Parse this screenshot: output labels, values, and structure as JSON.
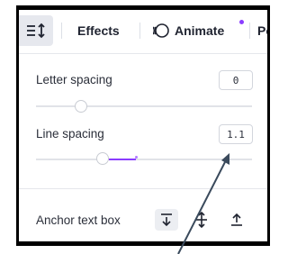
{
  "toolbar": {
    "effects_label": "Effects",
    "animate_label": "Animate",
    "more_label": "Po",
    "animate_dot_color": "#8b3dff"
  },
  "letter_spacing": {
    "label": "Letter spacing",
    "value": "0",
    "slider_fraction": 0.0
  },
  "line_spacing": {
    "label": "Line spacing",
    "value": "1.1",
    "accent_color": "#8b3dff"
  },
  "anchor": {
    "label": "Anchor text box",
    "options": [
      "anchor-bottom",
      "anchor-middle",
      "anchor-top"
    ],
    "selected": "anchor-bottom"
  }
}
